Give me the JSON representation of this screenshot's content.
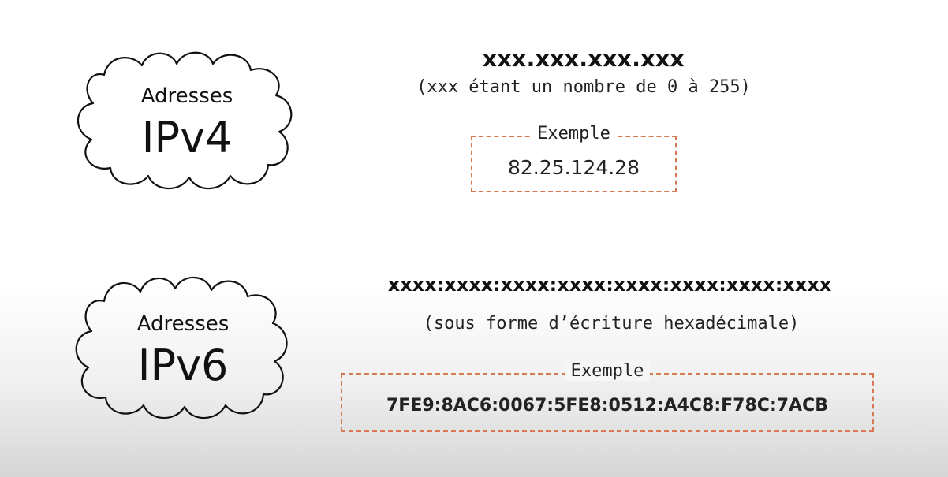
{
  "ipv4": {
    "label_small": "Adresses",
    "label_big": "IPv4",
    "format": "xxx.xxx.xxx.xxx",
    "note": "(xxx étant un nombre de 0 à 255)",
    "example_title": "Exemple",
    "example_value": "82.25.124.28"
  },
  "ipv6": {
    "label_small": "Adresses",
    "label_big": "IPv6",
    "format": "xxxx:xxxx:xxxx:xxxx:xxxx:xxxx:xxxx:xxxx",
    "note": "(sous forme d’écriture hexadécimale)",
    "example_title": "Exemple",
    "example_value": "7FE9:8AC6:0067:5FE8:0512:A4C8:F78C:7ACB"
  },
  "colors": {
    "accent": "#d47a52",
    "ink": "#111111"
  }
}
